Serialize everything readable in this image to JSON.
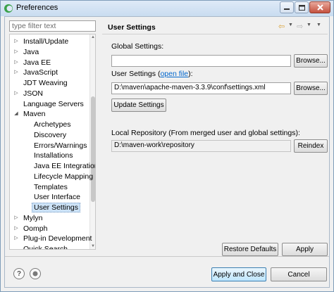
{
  "window": {
    "title": "Preferences"
  },
  "filter": {
    "placeholder": "type filter text"
  },
  "tree": {
    "items": [
      {
        "label": "Install/Update",
        "expandable": true,
        "expanded": false,
        "level": 0
      },
      {
        "label": "Java",
        "expandable": true,
        "expanded": false,
        "level": 0
      },
      {
        "label": "Java EE",
        "expandable": true,
        "expanded": false,
        "level": 0
      },
      {
        "label": "JavaScript",
        "expandable": true,
        "expanded": false,
        "level": 0
      },
      {
        "label": "JDT Weaving",
        "expandable": false,
        "expanded": false,
        "level": 0
      },
      {
        "label": "JSON",
        "expandable": true,
        "expanded": false,
        "level": 0
      },
      {
        "label": "Language Servers",
        "expandable": false,
        "expanded": false,
        "level": 0
      },
      {
        "label": "Maven",
        "expandable": true,
        "expanded": true,
        "level": 0
      },
      {
        "label": "Archetypes",
        "expandable": false,
        "expanded": false,
        "level": 1
      },
      {
        "label": "Discovery",
        "expandable": false,
        "expanded": false,
        "level": 1
      },
      {
        "label": "Errors/Warnings",
        "expandable": false,
        "expanded": false,
        "level": 1
      },
      {
        "label": "Installations",
        "expandable": false,
        "expanded": false,
        "level": 1
      },
      {
        "label": "Java EE Integration",
        "expandable": false,
        "expanded": false,
        "level": 1
      },
      {
        "label": "Lifecycle Mapping",
        "expandable": false,
        "expanded": false,
        "level": 1
      },
      {
        "label": "Templates",
        "expandable": false,
        "expanded": false,
        "level": 1
      },
      {
        "label": "User Interface",
        "expandable": false,
        "expanded": false,
        "level": 1
      },
      {
        "label": "User Settings",
        "expandable": false,
        "expanded": false,
        "level": 1,
        "selected": true
      },
      {
        "label": "Mylyn",
        "expandable": true,
        "expanded": false,
        "level": 0
      },
      {
        "label": "Oomph",
        "expandable": true,
        "expanded": false,
        "level": 0
      },
      {
        "label": "Plug-in Development",
        "expandable": true,
        "expanded": false,
        "level": 0
      },
      {
        "label": "Quick Search",
        "expandable": false,
        "expanded": false,
        "level": 0
      }
    ]
  },
  "panel": {
    "title": "User Settings",
    "global_settings_label": "Global Settings:",
    "global_settings_value": "",
    "browse_label": "Browse...",
    "user_settings_label": "User Settings (",
    "user_settings_link": "open file",
    "user_settings_label_end": "):",
    "user_settings_value": "D:\\maven\\apache-maven-3.3.9\\conf\\settings.xml",
    "update_settings_label": "Update Settings",
    "local_repo_label": "Local Repository (From merged user and global settings):",
    "local_repo_value": "D:\\maven-work\\repository",
    "reindex_label": "Reindex",
    "restore_defaults_label": "Restore Defaults",
    "apply_label": "Apply"
  },
  "footer": {
    "help_glyph": "?",
    "apply_close_label": "Apply and Close",
    "cancel_label": "Cancel"
  },
  "icons": {
    "back": "back-arrow-icon",
    "forward": "forward-arrow-icon",
    "menu": "view-menu-icon",
    "help": "help-icon",
    "import_export": "import-export-icon"
  },
  "colors": {
    "link": "#0066cc",
    "selection": "#cde3f7",
    "back_arrow": "#d9a33a"
  }
}
